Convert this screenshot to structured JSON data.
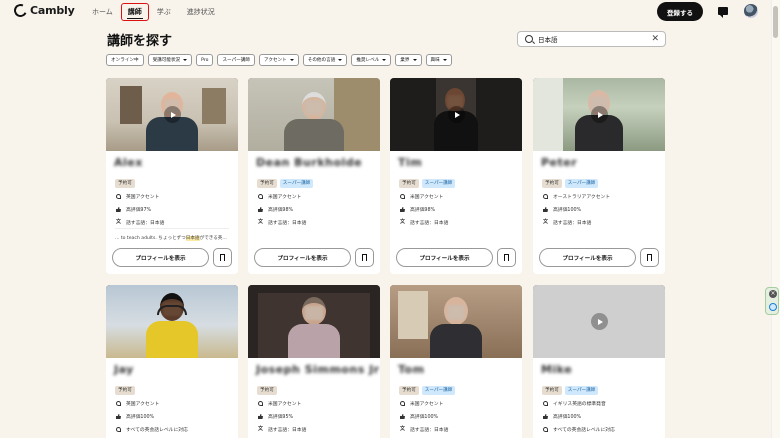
{
  "nav": {
    "logo": "Cambly",
    "links": [
      "ホーム",
      "講師",
      "学ぶ",
      "進捗状況"
    ],
    "signup": "登録する"
  },
  "page": {
    "title": "講師を探す"
  },
  "search": {
    "value": "日本語"
  },
  "filters": [
    "オンライン中",
    "受講可能状況",
    "Pro",
    "スーパー講師",
    "アクセント",
    "その他の言語",
    "推奨レベル",
    "業界",
    "興味"
  ],
  "filter_dropdowns": [
    false,
    true,
    false,
    false,
    true,
    true,
    true,
    true,
    true
  ],
  "card_common": {
    "profile_btn": "プロフィールを表示"
  },
  "tutors": [
    {
      "name": "Alex",
      "badges": [
        "予約可"
      ],
      "accent": "英国アクセント",
      "rating": "高評価97%",
      "langs": "話す言語：日本語",
      "bio_pre": "... to teach adults. ちょっとずつ",
      "bio_hl": "日本語",
      "bio_post": "ができる英..."
    },
    {
      "name": "Dean Burkholde",
      "badges": [
        "予約可",
        "スーパー講師"
      ],
      "accent": "米国アクセント",
      "rating": "高評価98%",
      "langs": "話す言語：日本語"
    },
    {
      "name": "Tim",
      "badges": [
        "予約可",
        "スーパー講師"
      ],
      "accent": "米国アクセント",
      "rating": "高評価98%",
      "langs": "話す言語：日本語"
    },
    {
      "name": "Peter",
      "badges": [
        "予約可",
        "スーパー講師"
      ],
      "accent": "オーストラリアアクセント",
      "rating": "高評価100%",
      "langs": "話す言語：日本語"
    },
    {
      "name": "Jay",
      "badges": [
        "予約可"
      ],
      "accent": "英国アクセント",
      "rating": "高評価100%",
      "langs": "すべての英会話レベルに対応"
    },
    {
      "name": "Joseph Simmons Jr",
      "badges": [
        "予約可"
      ],
      "accent": "米国アクセント",
      "rating": "高評価95%",
      "langs": "話す言語：日本語"
    },
    {
      "name": "Tom",
      "badges": [
        "予約可",
        "スーパー講師"
      ],
      "accent": "米国アクセント",
      "rating": "高評価100%",
      "langs": "話す言語：日本語"
    },
    {
      "name": "Mike",
      "badges": [
        "予約可",
        "スーパー講師"
      ],
      "accent": "イギリス英語の標準発音",
      "rating": "高評価100%",
      "langs": "すべての英会話レベルに対応"
    }
  ]
}
